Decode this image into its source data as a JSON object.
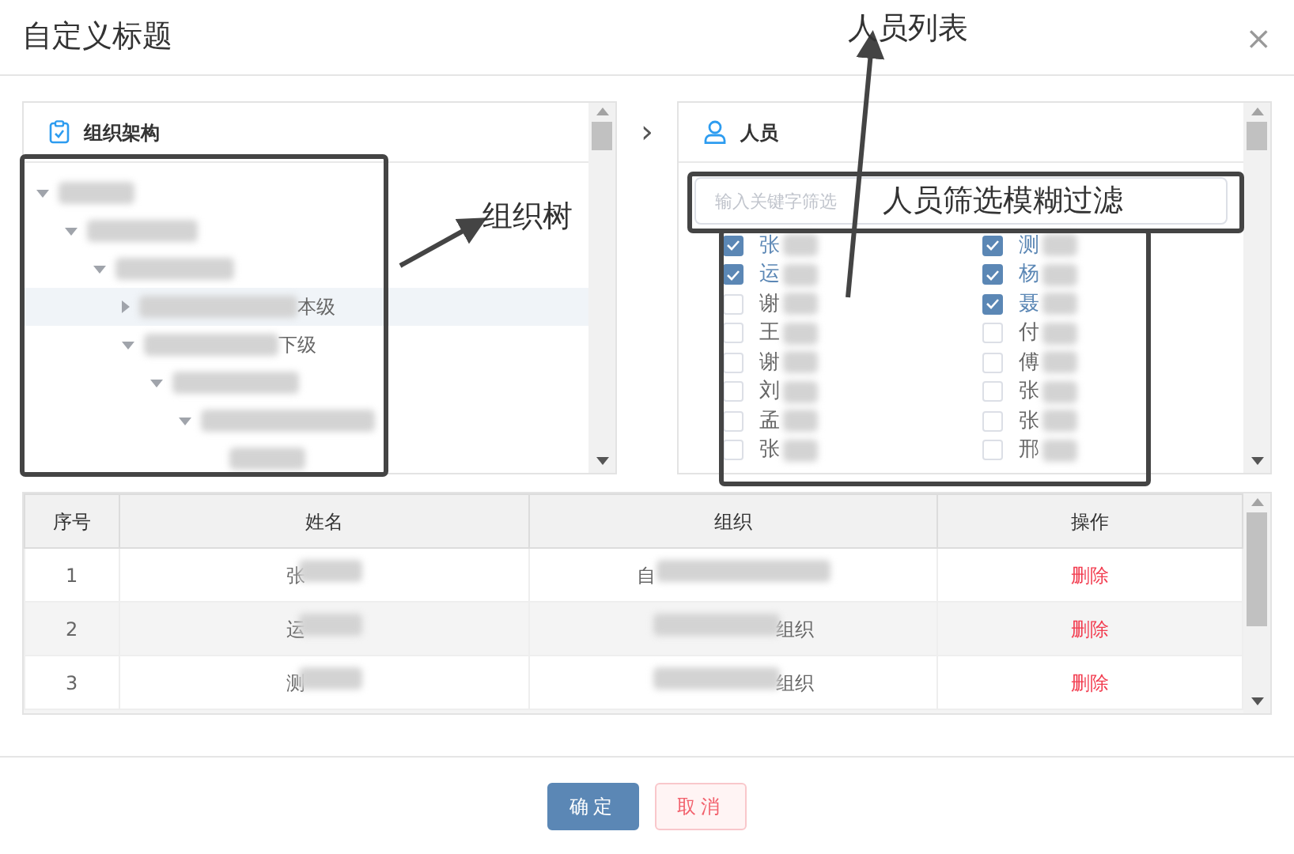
{
  "dialog": {
    "title": "自定义标题",
    "close": "×"
  },
  "org_panel": {
    "title": "组织架构",
    "tree": [
      {
        "blurred": true,
        "expanded": true,
        "selected": false,
        "children": [
          {
            "blurred": true,
            "expanded": true,
            "selected": false,
            "children": [
              {
                "blurred": true,
                "expanded": true,
                "selected": false,
                "children": [
                  {
                    "label": "本级",
                    "blurred": true,
                    "expanded": false,
                    "selected": true
                  },
                  {
                    "label": "下级",
                    "blurred": true,
                    "expanded": true,
                    "selected": false,
                    "children": [
                      {
                        "blurred": true,
                        "expanded": true,
                        "selected": false,
                        "children": [
                          {
                            "blurred": true,
                            "expanded": true,
                            "selected": false,
                            "children": [
                              {
                                "blurred": true,
                                "selected": false
                              }
                            ]
                          }
                        ]
                      }
                    ]
                  }
                ]
              }
            ]
          }
        ]
      }
    ]
  },
  "transfer_arrow": "›",
  "people_panel": {
    "title": "人员",
    "search": {
      "placeholder": "输入关键字筛选"
    },
    "people": [
      {
        "name": "张",
        "checked": true,
        "blurred": true
      },
      {
        "name": "测",
        "checked": true,
        "blurred": true
      },
      {
        "name": "运",
        "checked": true,
        "blurred": true
      },
      {
        "name": "杨",
        "checked": true,
        "blurred": true
      },
      {
        "name": "谢",
        "checked": false,
        "blurred": true
      },
      {
        "name": "聂",
        "checked": true,
        "blurred": true
      },
      {
        "name": "王",
        "checked": false,
        "blurred": true
      },
      {
        "name": "付",
        "checked": false,
        "blurred": true
      },
      {
        "name": "谢",
        "checked": false,
        "blurred": true
      },
      {
        "name": "傅",
        "checked": false,
        "blurred": true
      },
      {
        "name": "刘",
        "checked": false,
        "blurred": true
      },
      {
        "name": "张",
        "checked": false,
        "blurred": true
      },
      {
        "name": "孟",
        "checked": false,
        "blurred": true
      },
      {
        "name": "张",
        "checked": false,
        "blurred": true
      },
      {
        "name": "张",
        "checked": false,
        "blurred": true
      },
      {
        "name": "邢",
        "checked": false,
        "blurred": true
      }
    ]
  },
  "table": {
    "columns": [
      "序号",
      "姓名",
      "组织",
      "操作"
    ],
    "rows": [
      {
        "index": "1",
        "name": "张",
        "org": "自",
        "action": "删除"
      },
      {
        "index": "2",
        "name": "运",
        "org": "组织",
        "action": "删除"
      },
      {
        "index": "3",
        "name": "测",
        "org": "组织",
        "action": "删除"
      }
    ]
  },
  "buttons": [
    {
      "label": "确定",
      "kind": "primary"
    },
    {
      "label": "取消",
      "kind": "cancel"
    }
  ],
  "annotations": [
    {
      "label": "组织树"
    },
    {
      "label": "人员列表"
    },
    {
      "label": "人员筛选模糊过滤"
    }
  ]
}
